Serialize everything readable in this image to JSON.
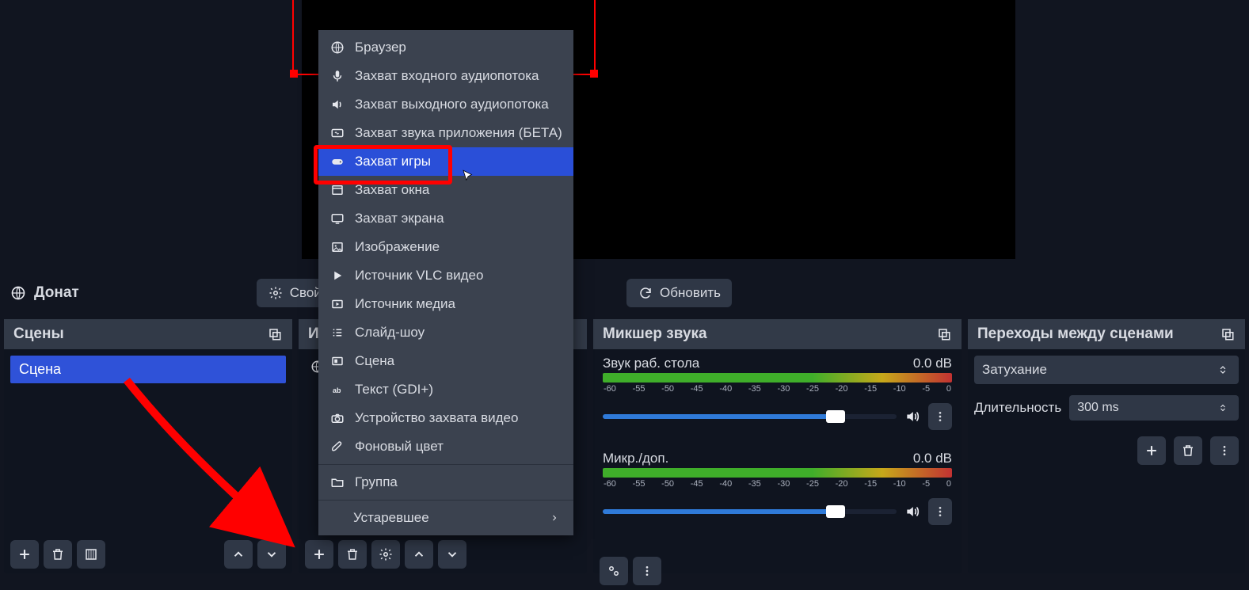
{
  "strip": {
    "donate_label": "Донат",
    "properties_label": "Свойства",
    "refresh_label": "Обновить"
  },
  "panels": {
    "scenes": {
      "title": "Сцены",
      "item": "Сцена"
    },
    "sources": {
      "title": "И"
    },
    "mixer": {
      "title": "Микшер звука",
      "ch1": {
        "name": "Звук раб. стола",
        "db": "0.0 dB"
      },
      "ch2": {
        "name": "Микр./доп.",
        "db": "0.0 dB"
      },
      "ticks": [
        "-60",
        "-55",
        "-50",
        "-45",
        "-40",
        "-35",
        "-30",
        "-25",
        "-20",
        "-15",
        "-10",
        "-5",
        "0"
      ]
    },
    "transitions": {
      "title": "Переходы между сценами",
      "selected": "Затухание",
      "duration_label": "Длительность",
      "duration_value": "300 ms"
    }
  },
  "context": {
    "items": [
      {
        "icon": "globe",
        "label": "Браузер"
      },
      {
        "icon": "mic",
        "label": "Захват входного аудиопотока"
      },
      {
        "icon": "speaker",
        "label": "Захват выходного аудиопотока"
      },
      {
        "icon": "app-audio",
        "label": "Захват звука приложения (БЕТА)"
      },
      {
        "icon": "gamepad",
        "label": "Захват игры",
        "selected": true
      },
      {
        "icon": "window",
        "label": "Захват окна"
      },
      {
        "icon": "screen",
        "label": "Захват экрана"
      },
      {
        "icon": "image",
        "label": "Изображение"
      },
      {
        "icon": "play",
        "label": "Источник VLC видео"
      },
      {
        "icon": "media",
        "label": "Источник медиа"
      },
      {
        "icon": "slides",
        "label": "Слайд-шоу"
      },
      {
        "icon": "scene",
        "label": "Сцена"
      },
      {
        "icon": "text",
        "label": "Текст (GDI+)"
      },
      {
        "icon": "camera",
        "label": "Устройство захвата видео"
      },
      {
        "icon": "brush",
        "label": "Фоновый цвет"
      }
    ],
    "group_label": "Группа",
    "deprecated_label": "Устаревшее"
  }
}
